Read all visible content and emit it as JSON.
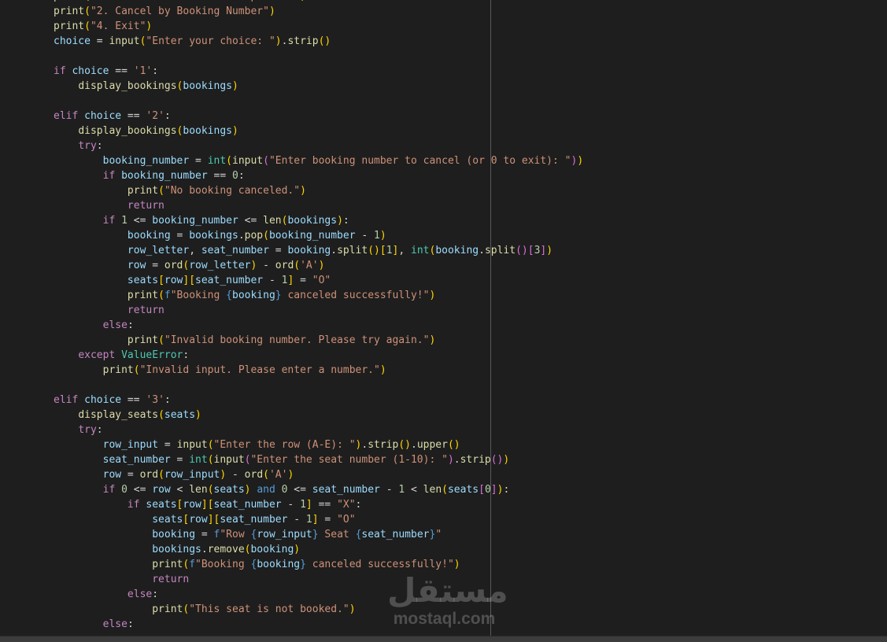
{
  "code_lines": [
    [
      {
        "c": "f",
        "t": "print"
      },
      {
        "c": "b1",
        "t": "("
      },
      {
        "c": "s",
        "t": "\"\\nAdvanced Cancellation Options:\""
      },
      {
        "c": "b1",
        "t": ")"
      }
    ],
    [
      {
        "c": "f",
        "t": "print"
      },
      {
        "c": "b1",
        "t": "("
      },
      {
        "c": "s",
        "t": "\"2. Cancel by Booking Number\""
      },
      {
        "c": "b1",
        "t": ")"
      }
    ],
    [
      {
        "c": "f",
        "t": "print"
      },
      {
        "c": "b1",
        "t": "("
      },
      {
        "c": "s",
        "t": "\"4. Exit\""
      },
      {
        "c": "b1",
        "t": ")"
      }
    ],
    [
      {
        "c": "v",
        "t": "choice"
      },
      {
        "c": "p",
        "t": " = "
      },
      {
        "c": "f",
        "t": "input"
      },
      {
        "c": "b1",
        "t": "("
      },
      {
        "c": "s",
        "t": "\"Enter your choice: \""
      },
      {
        "c": "b1",
        "t": ")"
      },
      {
        "c": "p",
        "t": "."
      },
      {
        "c": "f",
        "t": "strip"
      },
      {
        "c": "b1",
        "t": "()"
      }
    ],
    [],
    [
      {
        "c": "k",
        "t": "if"
      },
      {
        "c": "p",
        "t": " "
      },
      {
        "c": "v",
        "t": "choice"
      },
      {
        "c": "p",
        "t": " == "
      },
      {
        "c": "s",
        "t": "'1'"
      },
      {
        "c": "p",
        "t": ":"
      }
    ],
    [
      {
        "c": "ind",
        "t": "    "
      },
      {
        "c": "f",
        "t": "display_bookings"
      },
      {
        "c": "b1",
        "t": "("
      },
      {
        "c": "v",
        "t": "bookings"
      },
      {
        "c": "b1",
        "t": ")"
      }
    ],
    [],
    [
      {
        "c": "k",
        "t": "elif"
      },
      {
        "c": "p",
        "t": " "
      },
      {
        "c": "v",
        "t": "choice"
      },
      {
        "c": "p",
        "t": " == "
      },
      {
        "c": "s",
        "t": "'2'"
      },
      {
        "c": "p",
        "t": ":"
      }
    ],
    [
      {
        "c": "ind",
        "t": "    "
      },
      {
        "c": "f",
        "t": "display_bookings"
      },
      {
        "c": "b1",
        "t": "("
      },
      {
        "c": "v",
        "t": "bookings"
      },
      {
        "c": "b1",
        "t": ")"
      }
    ],
    [
      {
        "c": "ind",
        "t": "    "
      },
      {
        "c": "k",
        "t": "try"
      },
      {
        "c": "p",
        "t": ":"
      }
    ],
    [
      {
        "c": "ind",
        "t": "        "
      },
      {
        "c": "v",
        "t": "booking_number"
      },
      {
        "c": "p",
        "t": " = "
      },
      {
        "c": "t",
        "t": "int"
      },
      {
        "c": "b1",
        "t": "("
      },
      {
        "c": "f",
        "t": "input"
      },
      {
        "c": "b2",
        "t": "("
      },
      {
        "c": "s",
        "t": "\"Enter booking number to cancel (or 0 to exit): \""
      },
      {
        "c": "b2",
        "t": ")"
      },
      {
        "c": "b1",
        "t": ")"
      }
    ],
    [
      {
        "c": "ind",
        "t": "        "
      },
      {
        "c": "k",
        "t": "if"
      },
      {
        "c": "p",
        "t": " "
      },
      {
        "c": "v",
        "t": "booking_number"
      },
      {
        "c": "p",
        "t": " == "
      },
      {
        "c": "n",
        "t": "0"
      },
      {
        "c": "p",
        "t": ":"
      }
    ],
    [
      {
        "c": "ind",
        "t": "            "
      },
      {
        "c": "f",
        "t": "print"
      },
      {
        "c": "b1",
        "t": "("
      },
      {
        "c": "s",
        "t": "\"No booking canceled.\""
      },
      {
        "c": "b1",
        "t": ")"
      }
    ],
    [
      {
        "c": "ind",
        "t": "            "
      },
      {
        "c": "k",
        "t": "return"
      }
    ],
    [
      {
        "c": "ind",
        "t": "        "
      },
      {
        "c": "k",
        "t": "if"
      },
      {
        "c": "p",
        "t": " "
      },
      {
        "c": "n",
        "t": "1"
      },
      {
        "c": "p",
        "t": " <= "
      },
      {
        "c": "v",
        "t": "booking_number"
      },
      {
        "c": "p",
        "t": " <= "
      },
      {
        "c": "f",
        "t": "len"
      },
      {
        "c": "b1",
        "t": "("
      },
      {
        "c": "v",
        "t": "bookings"
      },
      {
        "c": "b1",
        "t": ")"
      },
      {
        "c": "p",
        "t": ":"
      }
    ],
    [
      {
        "c": "ind",
        "t": "            "
      },
      {
        "c": "v",
        "t": "booking"
      },
      {
        "c": "p",
        "t": " = "
      },
      {
        "c": "v",
        "t": "bookings"
      },
      {
        "c": "p",
        "t": "."
      },
      {
        "c": "f",
        "t": "pop"
      },
      {
        "c": "b1",
        "t": "("
      },
      {
        "c": "v",
        "t": "booking_number"
      },
      {
        "c": "p",
        "t": " - "
      },
      {
        "c": "n",
        "t": "1"
      },
      {
        "c": "b1",
        "t": ")"
      }
    ],
    [
      {
        "c": "ind",
        "t": "            "
      },
      {
        "c": "v",
        "t": "row_letter"
      },
      {
        "c": "p",
        "t": ", "
      },
      {
        "c": "v",
        "t": "seat_number"
      },
      {
        "c": "p",
        "t": " = "
      },
      {
        "c": "v",
        "t": "booking"
      },
      {
        "c": "p",
        "t": "."
      },
      {
        "c": "f",
        "t": "split"
      },
      {
        "c": "b1",
        "t": "()"
      },
      {
        "c": "b1",
        "t": "["
      },
      {
        "c": "n",
        "t": "1"
      },
      {
        "c": "b1",
        "t": "]"
      },
      {
        "c": "p",
        "t": ", "
      },
      {
        "c": "t",
        "t": "int"
      },
      {
        "c": "b1",
        "t": "("
      },
      {
        "c": "v",
        "t": "booking"
      },
      {
        "c": "p",
        "t": "."
      },
      {
        "c": "f",
        "t": "split"
      },
      {
        "c": "b2",
        "t": "()"
      },
      {
        "c": "b2",
        "t": "["
      },
      {
        "c": "n",
        "t": "3"
      },
      {
        "c": "b2",
        "t": "]"
      },
      {
        "c": "b1",
        "t": ")"
      }
    ],
    [
      {
        "c": "ind",
        "t": "            "
      },
      {
        "c": "v",
        "t": "row"
      },
      {
        "c": "p",
        "t": " = "
      },
      {
        "c": "f",
        "t": "ord"
      },
      {
        "c": "b1",
        "t": "("
      },
      {
        "c": "v",
        "t": "row_letter"
      },
      {
        "c": "b1",
        "t": ")"
      },
      {
        "c": "p",
        "t": " - "
      },
      {
        "c": "f",
        "t": "ord"
      },
      {
        "c": "b1",
        "t": "("
      },
      {
        "c": "s",
        "t": "'A'"
      },
      {
        "c": "b1",
        "t": ")"
      }
    ],
    [
      {
        "c": "ind",
        "t": "            "
      },
      {
        "c": "v",
        "t": "seats"
      },
      {
        "c": "b1",
        "t": "["
      },
      {
        "c": "v",
        "t": "row"
      },
      {
        "c": "b1",
        "t": "]"
      },
      {
        "c": "b1",
        "t": "["
      },
      {
        "c": "v",
        "t": "seat_number"
      },
      {
        "c": "p",
        "t": " - "
      },
      {
        "c": "n",
        "t": "1"
      },
      {
        "c": "b1",
        "t": "]"
      },
      {
        "c": "p",
        "t": " = "
      },
      {
        "c": "s",
        "t": "\"O\""
      }
    ],
    [
      {
        "c": "ind",
        "t": "            "
      },
      {
        "c": "f",
        "t": "print"
      },
      {
        "c": "b1",
        "t": "("
      },
      {
        "c": "kb",
        "t": "f"
      },
      {
        "c": "s",
        "t": "\"Booking "
      },
      {
        "c": "kb",
        "t": "{"
      },
      {
        "c": "v",
        "t": "booking"
      },
      {
        "c": "kb",
        "t": "}"
      },
      {
        "c": "s",
        "t": " canceled successfully!\""
      },
      {
        "c": "b1",
        "t": ")"
      }
    ],
    [
      {
        "c": "ind",
        "t": "            "
      },
      {
        "c": "k",
        "t": "return"
      }
    ],
    [
      {
        "c": "ind",
        "t": "        "
      },
      {
        "c": "k",
        "t": "else"
      },
      {
        "c": "p",
        "t": ":"
      }
    ],
    [
      {
        "c": "ind",
        "t": "            "
      },
      {
        "c": "f",
        "t": "print"
      },
      {
        "c": "b1",
        "t": "("
      },
      {
        "c": "s",
        "t": "\"Invalid booking number. Please try again.\""
      },
      {
        "c": "b1",
        "t": ")"
      }
    ],
    [
      {
        "c": "ind",
        "t": "    "
      },
      {
        "c": "k",
        "t": "except"
      },
      {
        "c": "p",
        "t": " "
      },
      {
        "c": "t",
        "t": "ValueError"
      },
      {
        "c": "p",
        "t": ":"
      }
    ],
    [
      {
        "c": "ind",
        "t": "        "
      },
      {
        "c": "f",
        "t": "print"
      },
      {
        "c": "b1",
        "t": "("
      },
      {
        "c": "s",
        "t": "\"Invalid input. Please enter a number.\""
      },
      {
        "c": "b1",
        "t": ")"
      }
    ],
    [],
    [
      {
        "c": "k",
        "t": "elif"
      },
      {
        "c": "p",
        "t": " "
      },
      {
        "c": "v",
        "t": "choice"
      },
      {
        "c": "p",
        "t": " == "
      },
      {
        "c": "s",
        "t": "'3'"
      },
      {
        "c": "p",
        "t": ":"
      }
    ],
    [
      {
        "c": "ind",
        "t": "    "
      },
      {
        "c": "f",
        "t": "display_seats"
      },
      {
        "c": "b1",
        "t": "("
      },
      {
        "c": "v",
        "t": "seats"
      },
      {
        "c": "b1",
        "t": ")"
      }
    ],
    [
      {
        "c": "ind",
        "t": "    "
      },
      {
        "c": "k",
        "t": "try"
      },
      {
        "c": "p",
        "t": ":"
      }
    ],
    [
      {
        "c": "ind",
        "t": "        "
      },
      {
        "c": "v",
        "t": "row_input"
      },
      {
        "c": "p",
        "t": " = "
      },
      {
        "c": "f",
        "t": "input"
      },
      {
        "c": "b1",
        "t": "("
      },
      {
        "c": "s",
        "t": "\"Enter the row (A-E): \""
      },
      {
        "c": "b1",
        "t": ")"
      },
      {
        "c": "p",
        "t": "."
      },
      {
        "c": "f",
        "t": "strip"
      },
      {
        "c": "b1",
        "t": "()"
      },
      {
        "c": "p",
        "t": "."
      },
      {
        "c": "f",
        "t": "upper"
      },
      {
        "c": "b1",
        "t": "()"
      }
    ],
    [
      {
        "c": "ind",
        "t": "        "
      },
      {
        "c": "v",
        "t": "seat_number"
      },
      {
        "c": "p",
        "t": " = "
      },
      {
        "c": "t",
        "t": "int"
      },
      {
        "c": "b1",
        "t": "("
      },
      {
        "c": "f",
        "t": "input"
      },
      {
        "c": "b2",
        "t": "("
      },
      {
        "c": "s",
        "t": "\"Enter the seat number (1-10): \""
      },
      {
        "c": "b2",
        "t": ")"
      },
      {
        "c": "p",
        "t": "."
      },
      {
        "c": "f",
        "t": "strip"
      },
      {
        "c": "b2",
        "t": "()"
      },
      {
        "c": "b1",
        "t": ")"
      }
    ],
    [
      {
        "c": "ind",
        "t": "        "
      },
      {
        "c": "v",
        "t": "row"
      },
      {
        "c": "p",
        "t": " = "
      },
      {
        "c": "f",
        "t": "ord"
      },
      {
        "c": "b1",
        "t": "("
      },
      {
        "c": "v",
        "t": "row_input"
      },
      {
        "c": "b1",
        "t": ")"
      },
      {
        "c": "p",
        "t": " - "
      },
      {
        "c": "f",
        "t": "ord"
      },
      {
        "c": "b1",
        "t": "("
      },
      {
        "c": "s",
        "t": "'A'"
      },
      {
        "c": "b1",
        "t": ")"
      }
    ],
    [
      {
        "c": "ind",
        "t": "        "
      },
      {
        "c": "k",
        "t": "if"
      },
      {
        "c": "p",
        "t": " "
      },
      {
        "c": "n",
        "t": "0"
      },
      {
        "c": "p",
        "t": " <= "
      },
      {
        "c": "v",
        "t": "row"
      },
      {
        "c": "p",
        "t": " < "
      },
      {
        "c": "f",
        "t": "len"
      },
      {
        "c": "b1",
        "t": "("
      },
      {
        "c": "v",
        "t": "seats"
      },
      {
        "c": "b1",
        "t": ")"
      },
      {
        "c": "p",
        "t": " "
      },
      {
        "c": "kb",
        "t": "and"
      },
      {
        "c": "p",
        "t": " "
      },
      {
        "c": "n",
        "t": "0"
      },
      {
        "c": "p",
        "t": " <= "
      },
      {
        "c": "v",
        "t": "seat_number"
      },
      {
        "c": "p",
        "t": " - "
      },
      {
        "c": "n",
        "t": "1"
      },
      {
        "c": "p",
        "t": " < "
      },
      {
        "c": "f",
        "t": "len"
      },
      {
        "c": "b1",
        "t": "("
      },
      {
        "c": "v",
        "t": "seats"
      },
      {
        "c": "b2",
        "t": "["
      },
      {
        "c": "n",
        "t": "0"
      },
      {
        "c": "b2",
        "t": "]"
      },
      {
        "c": "b1",
        "t": ")"
      },
      {
        "c": "p",
        "t": ":"
      }
    ],
    [
      {
        "c": "ind",
        "t": "            "
      },
      {
        "c": "k",
        "t": "if"
      },
      {
        "c": "p",
        "t": " "
      },
      {
        "c": "v",
        "t": "seats"
      },
      {
        "c": "b1",
        "t": "["
      },
      {
        "c": "v",
        "t": "row"
      },
      {
        "c": "b1",
        "t": "]"
      },
      {
        "c": "b1",
        "t": "["
      },
      {
        "c": "v",
        "t": "seat_number"
      },
      {
        "c": "p",
        "t": " - "
      },
      {
        "c": "n",
        "t": "1"
      },
      {
        "c": "b1",
        "t": "]"
      },
      {
        "c": "p",
        "t": " == "
      },
      {
        "c": "s",
        "t": "\"X\""
      },
      {
        "c": "p",
        "t": ":"
      }
    ],
    [
      {
        "c": "ind",
        "t": "                "
      },
      {
        "c": "v",
        "t": "seats"
      },
      {
        "c": "b1",
        "t": "["
      },
      {
        "c": "v",
        "t": "row"
      },
      {
        "c": "b1",
        "t": "]"
      },
      {
        "c": "b1",
        "t": "["
      },
      {
        "c": "v",
        "t": "seat_number"
      },
      {
        "c": "p",
        "t": " - "
      },
      {
        "c": "n",
        "t": "1"
      },
      {
        "c": "b1",
        "t": "]"
      },
      {
        "c": "p",
        "t": " = "
      },
      {
        "c": "s",
        "t": "\"O\""
      }
    ],
    [
      {
        "c": "ind",
        "t": "                "
      },
      {
        "c": "v",
        "t": "booking"
      },
      {
        "c": "p",
        "t": " = "
      },
      {
        "c": "kb",
        "t": "f"
      },
      {
        "c": "s",
        "t": "\"Row "
      },
      {
        "c": "kb",
        "t": "{"
      },
      {
        "c": "v",
        "t": "row_input"
      },
      {
        "c": "kb",
        "t": "}"
      },
      {
        "c": "s",
        "t": " Seat "
      },
      {
        "c": "kb",
        "t": "{"
      },
      {
        "c": "v",
        "t": "seat_number"
      },
      {
        "c": "kb",
        "t": "}"
      },
      {
        "c": "s",
        "t": "\""
      }
    ],
    [
      {
        "c": "ind",
        "t": "                "
      },
      {
        "c": "v",
        "t": "bookings"
      },
      {
        "c": "p",
        "t": "."
      },
      {
        "c": "f",
        "t": "remove"
      },
      {
        "c": "b1",
        "t": "("
      },
      {
        "c": "v",
        "t": "booking"
      },
      {
        "c": "b1",
        "t": ")"
      }
    ],
    [
      {
        "c": "ind",
        "t": "                "
      },
      {
        "c": "f",
        "t": "print"
      },
      {
        "c": "b1",
        "t": "("
      },
      {
        "c": "kb",
        "t": "f"
      },
      {
        "c": "s",
        "t": "\"Booking "
      },
      {
        "c": "kb",
        "t": "{"
      },
      {
        "c": "v",
        "t": "booking"
      },
      {
        "c": "kb",
        "t": "}"
      },
      {
        "c": "s",
        "t": " canceled successfully!\""
      },
      {
        "c": "b1",
        "t": ")"
      }
    ],
    [
      {
        "c": "ind",
        "t": "                "
      },
      {
        "c": "k",
        "t": "return"
      }
    ],
    [
      {
        "c": "ind",
        "t": "            "
      },
      {
        "c": "k",
        "t": "else"
      },
      {
        "c": "p",
        "t": ":"
      }
    ],
    [
      {
        "c": "ind",
        "t": "                "
      },
      {
        "c": "f",
        "t": "print"
      },
      {
        "c": "b1",
        "t": "("
      },
      {
        "c": "s",
        "t": "\"This seat is not booked.\""
      },
      {
        "c": "b1",
        "t": ")"
      }
    ],
    [
      {
        "c": "ind",
        "t": "        "
      },
      {
        "c": "k",
        "t": "else"
      },
      {
        "c": "p",
        "t": ":"
      }
    ]
  ],
  "watermark": {
    "arabic": "مستقل",
    "latin": "mostaql.com"
  },
  "colors": {
    "background": "#1e1e1e",
    "keyword": "#c586c0",
    "function": "#dcdcaa",
    "variable": "#9cdcfe",
    "string": "#ce9178",
    "number": "#b5cea8",
    "type": "#4ec9b0",
    "bracket_level_1": "#ffd700",
    "bracket_level_2": "#da70d6"
  }
}
